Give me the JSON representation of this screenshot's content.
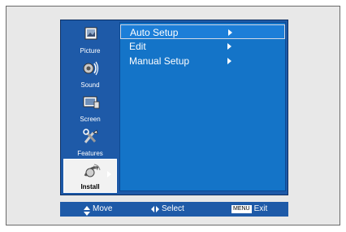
{
  "sidebar": {
    "items": [
      {
        "label": "Picture",
        "icon": "picture-icon"
      },
      {
        "label": "Sound",
        "icon": "sound-icon"
      },
      {
        "label": "Screen",
        "icon": "screen-icon"
      },
      {
        "label": "Features",
        "icon": "features-icon"
      },
      {
        "label": "Install",
        "icon": "install-icon",
        "selected": true
      }
    ]
  },
  "menu": {
    "items": [
      {
        "label": "Auto Setup",
        "highlighted": true
      },
      {
        "label": "Edit"
      },
      {
        "label": "Manual Setup"
      }
    ]
  },
  "status": {
    "move_label": "Move",
    "select_label": "Select",
    "menu_key": "MENU",
    "exit_label": "Exit"
  },
  "colors": {
    "osd_background": "#1e5aa8",
    "content_background": "#1474c8",
    "frame_background": "#e8e8e8"
  }
}
